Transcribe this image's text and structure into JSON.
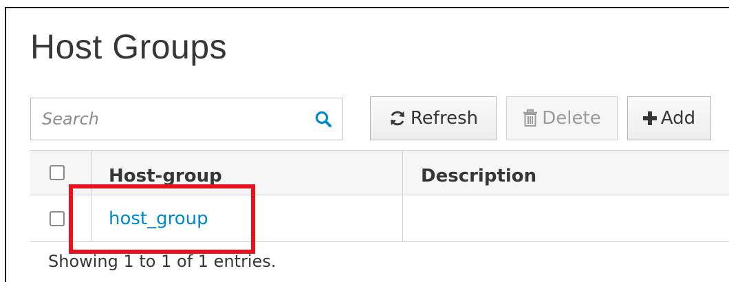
{
  "page": {
    "title": "Host Groups"
  },
  "search": {
    "placeholder": "Search",
    "value": ""
  },
  "toolbar": {
    "refresh_label": "Refresh",
    "delete_label": "Delete",
    "add_label": "Add"
  },
  "table": {
    "columns": [
      "Host-group",
      "Description"
    ],
    "rows": [
      {
        "name": "host_group",
        "description": ""
      }
    ]
  },
  "footer": {
    "entries_text": "Showing 1 to 1 of 1 entries."
  },
  "colors": {
    "link": "#0088ce",
    "highlight": "#e8121d",
    "search_icon": "#0088ce"
  },
  "icons": {
    "search": "search-icon",
    "refresh": "refresh-icon",
    "delete": "trash-icon",
    "add": "plus-icon"
  }
}
